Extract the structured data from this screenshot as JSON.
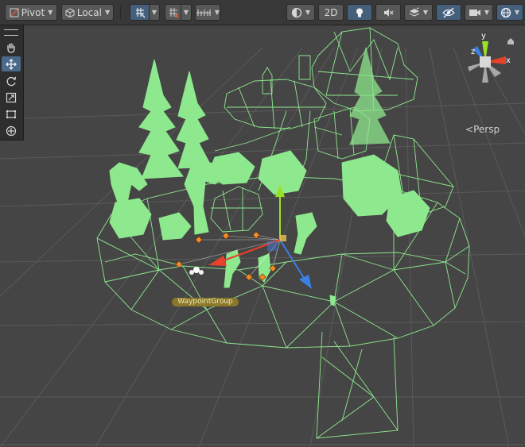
{
  "toolbar": {
    "pivot_label": "Pivot",
    "local_label": "Local",
    "mode_2d_label": "2D"
  },
  "tools": [
    "hand-tool",
    "move-tool",
    "rotate-tool",
    "scale-tool",
    "rect-tool",
    "transform-tool"
  ],
  "scene": {
    "view_label": "Persp",
    "gizmo_axes": {
      "x": "x",
      "y": "y",
      "z": "z"
    },
    "waypoint_label": "WaypointGroup"
  },
  "colors": {
    "wireframe": "#8ee88e",
    "selection": "#8cf58c",
    "toolbar_active": "#46607c",
    "x_axis": "#e8412c",
    "y_axis": "#9ae02a",
    "z_axis": "#3a80e6"
  }
}
